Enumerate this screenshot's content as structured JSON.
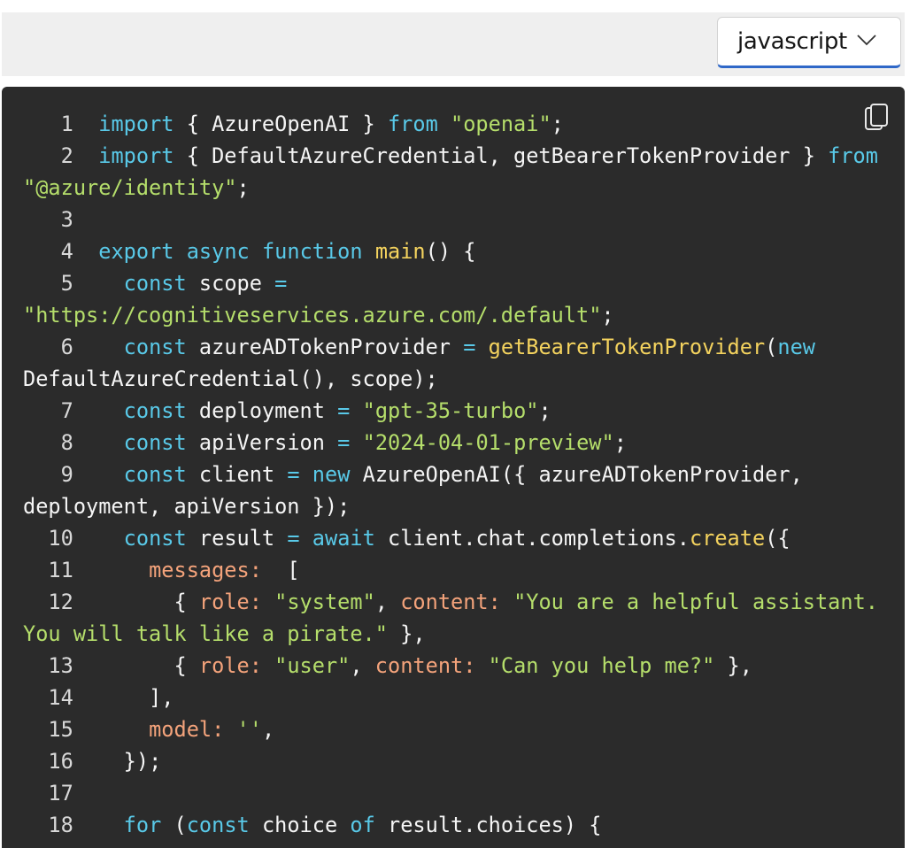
{
  "toolbar": {
    "language": "javascript",
    "chevron_icon": "chevron-down-icon",
    "copy_icon": "copy-icon"
  },
  "colors": {
    "background": "#2b2b2b",
    "keyword": "#59c9e8",
    "string": "#b5de6b",
    "function": "#f4d35e",
    "property": "#f4a37b",
    "plain": "#f5f5f5",
    "select_accent": "#2f68c8"
  },
  "code": {
    "lines": [
      {
        "n": "1",
        "tokens": [
          [
            "kw",
            "import"
          ],
          [
            "pl",
            " { AzureOpenAI } "
          ],
          [
            "kw",
            "from"
          ],
          [
            "pl",
            " "
          ],
          [
            "str",
            "\"openai\""
          ],
          [
            "pl",
            ";"
          ]
        ]
      },
      {
        "n": "2",
        "tokens": [
          [
            "kw",
            "import"
          ],
          [
            "pl",
            " { DefaultAzureCredential, getBearerTokenProvider } "
          ],
          [
            "kw",
            "from"
          ],
          [
            "pl",
            " "
          ],
          [
            "str",
            "\"@azure/identity\""
          ],
          [
            "pl",
            ";"
          ]
        ]
      },
      {
        "n": "3",
        "tokens": []
      },
      {
        "n": "4",
        "tokens": [
          [
            "kw",
            "export"
          ],
          [
            "pl",
            " "
          ],
          [
            "kw",
            "async"
          ],
          [
            "pl",
            " "
          ],
          [
            "kw",
            "function"
          ],
          [
            "pl",
            " "
          ],
          [
            "fn",
            "main"
          ],
          [
            "pl",
            "() {"
          ]
        ]
      },
      {
        "n": "5",
        "tokens": [
          [
            "pl",
            "  "
          ],
          [
            "kw",
            "const"
          ],
          [
            "pl",
            " scope "
          ],
          [
            "kw",
            "="
          ],
          [
            "pl",
            " "
          ],
          [
            "str",
            "\"https://cognitiveservices.azure.com/.default\""
          ],
          [
            "pl",
            ";"
          ]
        ]
      },
      {
        "n": "6",
        "tokens": [
          [
            "pl",
            "  "
          ],
          [
            "kw",
            "const"
          ],
          [
            "pl",
            " azureADTokenProvider "
          ],
          [
            "kw",
            "="
          ],
          [
            "pl",
            " "
          ],
          [
            "fn",
            "getBearerTokenProvider"
          ],
          [
            "pl",
            "("
          ],
          [
            "kw",
            "new"
          ],
          [
            "pl",
            " DefaultAzureCredential(), scope);"
          ]
        ]
      },
      {
        "n": "7",
        "tokens": [
          [
            "pl",
            "  "
          ],
          [
            "kw",
            "const"
          ],
          [
            "pl",
            " deployment "
          ],
          [
            "kw",
            "="
          ],
          [
            "pl",
            " "
          ],
          [
            "str",
            "\"gpt-35-turbo\""
          ],
          [
            "pl",
            ";"
          ]
        ]
      },
      {
        "n": "8",
        "tokens": [
          [
            "pl",
            "  "
          ],
          [
            "kw",
            "const"
          ],
          [
            "pl",
            " apiVersion "
          ],
          [
            "kw",
            "="
          ],
          [
            "pl",
            " "
          ],
          [
            "str",
            "\"2024-04-01-preview\""
          ],
          [
            "pl",
            ";"
          ]
        ]
      },
      {
        "n": "9",
        "tokens": [
          [
            "pl",
            "  "
          ],
          [
            "kw",
            "const"
          ],
          [
            "pl",
            " client "
          ],
          [
            "kw",
            "="
          ],
          [
            "pl",
            " "
          ],
          [
            "kw",
            "new"
          ],
          [
            "pl",
            " AzureOpenAI({ azureADTokenProvider, deployment, apiVersion });"
          ]
        ]
      },
      {
        "n": "10",
        "tokens": [
          [
            "pl",
            "  "
          ],
          [
            "kw",
            "const"
          ],
          [
            "pl",
            " result "
          ],
          [
            "kw",
            "="
          ],
          [
            "pl",
            " "
          ],
          [
            "kw",
            "await"
          ],
          [
            "pl",
            " client.chat.completions."
          ],
          [
            "fn",
            "create"
          ],
          [
            "pl",
            "({"
          ]
        ]
      },
      {
        "n": "11",
        "tokens": [
          [
            "pl",
            "    "
          ],
          [
            "prop",
            "messages:"
          ],
          [
            "pl",
            "  ["
          ]
        ]
      },
      {
        "n": "12",
        "tokens": [
          [
            "pl",
            "      { "
          ],
          [
            "prop",
            "role:"
          ],
          [
            "pl",
            " "
          ],
          [
            "str",
            "\"system\""
          ],
          [
            "pl",
            ", "
          ],
          [
            "prop",
            "content:"
          ],
          [
            "pl",
            " "
          ],
          [
            "str",
            "\"You are a helpful assistant. You will talk like a pirate.\""
          ],
          [
            "pl",
            " },"
          ]
        ]
      },
      {
        "n": "13",
        "tokens": [
          [
            "pl",
            "      { "
          ],
          [
            "prop",
            "role:"
          ],
          [
            "pl",
            " "
          ],
          [
            "str",
            "\"user\""
          ],
          [
            "pl",
            ", "
          ],
          [
            "prop",
            "content:"
          ],
          [
            "pl",
            " "
          ],
          [
            "str",
            "\"Can you help me?\""
          ],
          [
            "pl",
            " },"
          ]
        ]
      },
      {
        "n": "14",
        "tokens": [
          [
            "pl",
            "    ],"
          ]
        ]
      },
      {
        "n": "15",
        "tokens": [
          [
            "pl",
            "    "
          ],
          [
            "prop",
            "model:"
          ],
          [
            "pl",
            " "
          ],
          [
            "str",
            "''"
          ],
          [
            "pl",
            ","
          ]
        ]
      },
      {
        "n": "16",
        "tokens": [
          [
            "pl",
            "  });"
          ]
        ]
      },
      {
        "n": "17",
        "tokens": []
      },
      {
        "n": "18",
        "tokens": [
          [
            "pl",
            "  "
          ],
          [
            "kw",
            "for"
          ],
          [
            "pl",
            " ("
          ],
          [
            "kw",
            "const"
          ],
          [
            "pl",
            " choice "
          ],
          [
            "kw",
            "of"
          ],
          [
            "pl",
            " result.choices) {"
          ]
        ]
      }
    ]
  }
}
